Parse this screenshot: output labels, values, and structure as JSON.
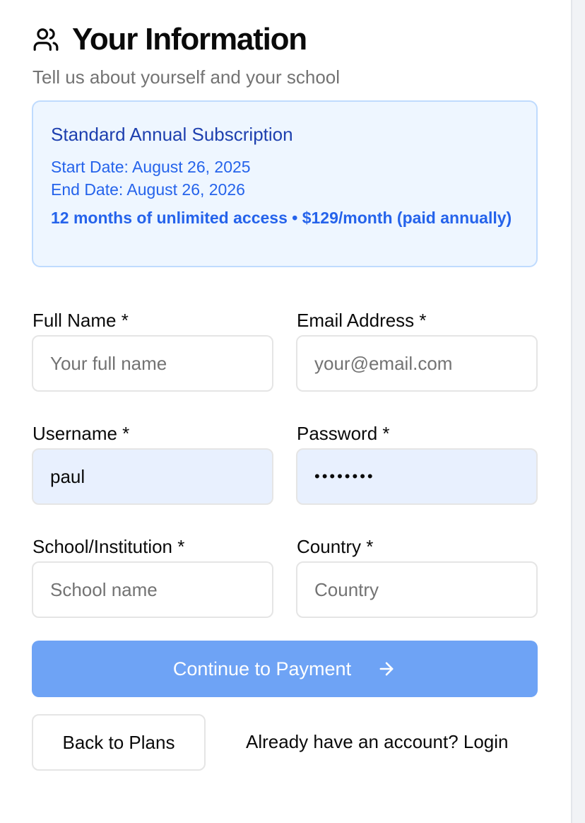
{
  "header": {
    "title": "Your Information",
    "subtitle": "Tell us about yourself and your school",
    "icon": "users-icon"
  },
  "plan": {
    "title": "Standard Annual Subscription",
    "start_date": "Start Date: August 26, 2025",
    "end_date": "End Date: August 26, 2026",
    "note": "12 months of unlimited access • $129/month (paid annually)"
  },
  "form": {
    "full_name": {
      "label": "Full Name *",
      "value": "",
      "placeholder": "Your full name"
    },
    "email": {
      "label": "Email Address *",
      "value": "",
      "placeholder": "your@email.com"
    },
    "username": {
      "label": "Username *",
      "value": "paul",
      "placeholder": ""
    },
    "password": {
      "label": "Password *",
      "value": "••••••••",
      "placeholder": ""
    },
    "school": {
      "label": "School/Institution *",
      "value": "",
      "placeholder": "School name"
    },
    "country": {
      "label": "Country *",
      "value": "",
      "placeholder": "Country"
    }
  },
  "actions": {
    "continue_label": "Continue to Payment",
    "continue_icon": "arrow-right-icon",
    "back_label": "Back to Plans",
    "login_text": "Already have an account? Login"
  },
  "colors": {
    "accent": "#6ea3f5",
    "plan_bg": "#eef6ff",
    "plan_border": "#bfdbfe",
    "plan_title": "#1e40af",
    "plan_text": "#2563eb",
    "autofill_bg": "#e8f0fe"
  }
}
